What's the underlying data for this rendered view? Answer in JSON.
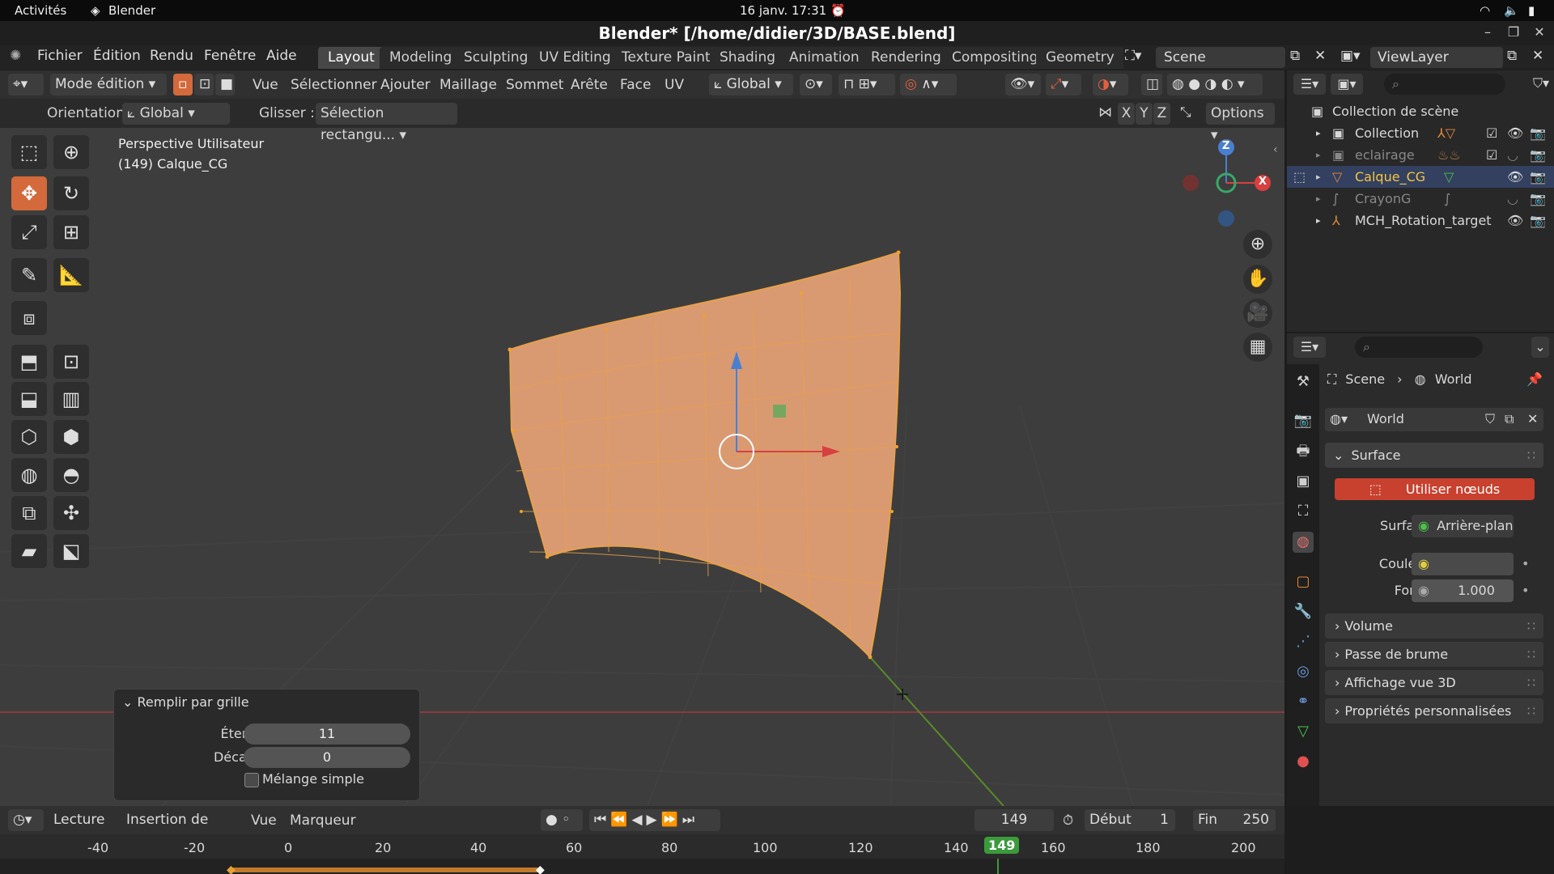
{
  "system_bar": {
    "activities": "Activités",
    "app": "Blender",
    "clock": "16 janv.  17:31"
  },
  "window": {
    "title": "Blender* [/home/didier/3D/BASE.blend]"
  },
  "menu": {
    "items": [
      "Fichier",
      "Édition",
      "Rendu",
      "Fenêtre",
      "Aide"
    ]
  },
  "workspaces": {
    "tabs": [
      "Layout",
      "Modeling",
      "Sculpting",
      "UV Editing",
      "Texture Paint",
      "Shading",
      "Animation",
      "Rendering",
      "Compositing",
      "Geometry N"
    ],
    "active": "Layout"
  },
  "scene": {
    "name": "Scene",
    "view_layer": "ViewLayer"
  },
  "viewport_header": {
    "mode": "Mode édition",
    "menus": [
      "Vue",
      "Sélectionner",
      "Ajouter",
      "Maillage",
      "Sommet",
      "Arête",
      "Face",
      "UV"
    ],
    "transform_orientation": "Global"
  },
  "tool_settings": {
    "orientation_label": "Orientation:",
    "orientation_value": "Global",
    "drag_label": "Glisser :",
    "drag_value": "Sélection rectangu...",
    "axes": [
      "X",
      "Y",
      "Z"
    ],
    "options": "Options"
  },
  "viewport": {
    "view_name": "Perspective Utilisateur",
    "object_info": "(149) Calque_CG",
    "gizmo_axes": {
      "z": "Z",
      "x": "X"
    }
  },
  "redo_panel": {
    "title": "Remplir par grille",
    "fields": [
      {
        "label": "Étendue",
        "value": "11"
      },
      {
        "label": "Décalage",
        "value": "0"
      }
    ],
    "checkbox_label": "Mélange simple",
    "checkbox_checked": false
  },
  "outliner": {
    "root": "Collection de scène",
    "rows": [
      {
        "name": "Collection",
        "active": false,
        "dim": false
      },
      {
        "name": "eclairage",
        "active": false,
        "dim": true
      },
      {
        "name": "Calque_CG",
        "active": true,
        "dim": false
      },
      {
        "name": "CrayonG",
        "active": false,
        "dim": true
      },
      {
        "name": "MCH_Rotation_target",
        "active": false,
        "dim": false
      }
    ]
  },
  "properties": {
    "breadcrumb": [
      "Scene",
      "World"
    ],
    "world_name": "World",
    "surface_panel": "Surface",
    "use_nodes_button": "Utiliser nœuds",
    "surface_label": "Surface",
    "surface_value": "Arrière-plan",
    "color_label": "Couleur",
    "strength_label": "Force",
    "strength_value": "1.000",
    "collapsed_panels": [
      "Volume",
      "Passe de brume",
      "Affichage vue 3D",
      "Propriétés personnalisées"
    ]
  },
  "timeline": {
    "menus": [
      "Lecture",
      "Insertion de clés",
      "Vue",
      "Marqueur"
    ],
    "current_frame": "149",
    "start_label": "Début",
    "start_value": "1",
    "end_label": "Fin",
    "end_value": "250",
    "ruler": [
      "-40",
      "-20",
      "0",
      "20",
      "40",
      "60",
      "80",
      "100",
      "120",
      "140",
      "149",
      "160",
      "180",
      "200"
    ]
  },
  "colors": {
    "accent": "#d4693b",
    "mesh": "#d99a72",
    "active_frame": "#3c9a3c",
    "selected_text": "#f5c542"
  }
}
